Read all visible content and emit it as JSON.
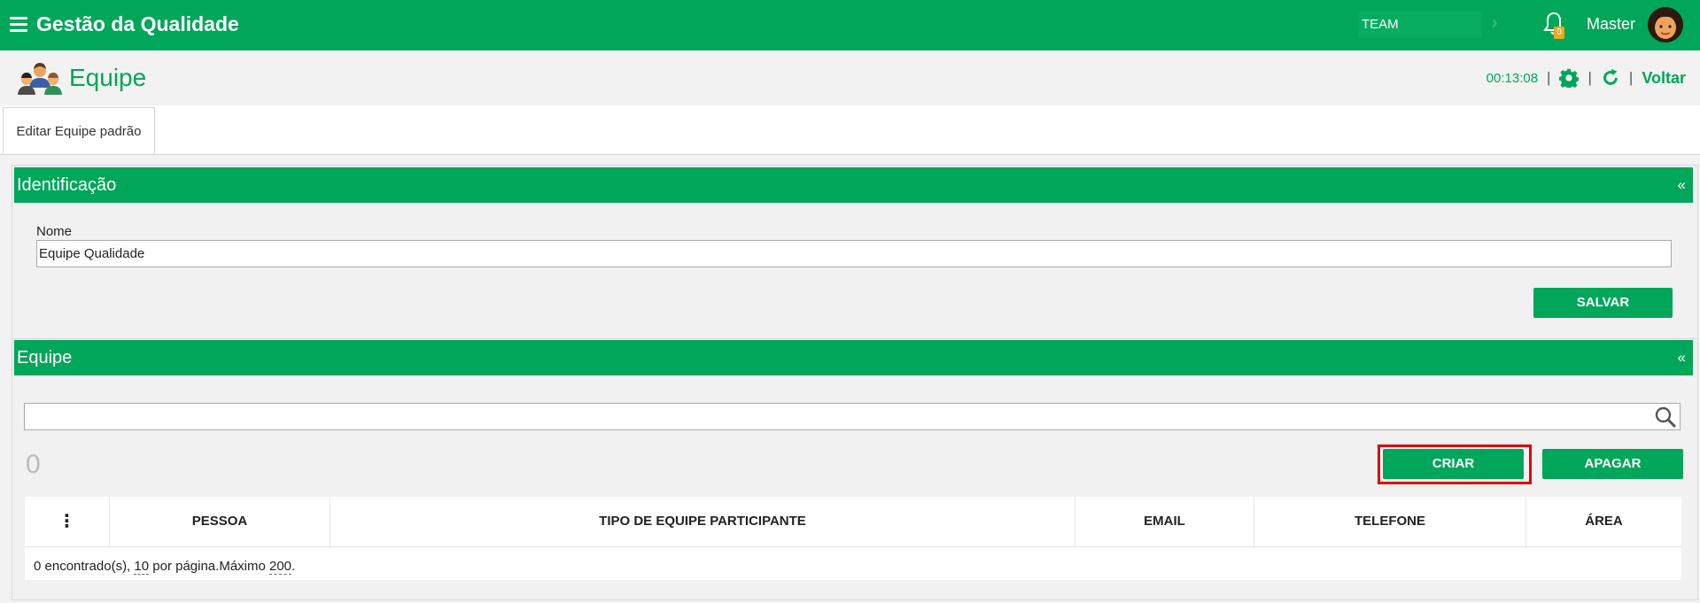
{
  "app": {
    "title": "Gestão da Qualidade",
    "team_selector": "TEAM",
    "notifications_count": "0",
    "user_name": "Master"
  },
  "page": {
    "title": "Equipe",
    "timer": "00:13:08",
    "back_label": "Voltar"
  },
  "tabs": [
    {
      "label": "Editar Equipe padrão"
    }
  ],
  "identification": {
    "section_title": "Identificação",
    "collapse_symbol": "«",
    "name_label": "Nome",
    "name_value": "Equipe Qualidade",
    "save_label": "SALVAR"
  },
  "team": {
    "section_title": "Equipe",
    "collapse_symbol": "«",
    "search_value": "",
    "count": "0",
    "create_label": "CRIAR",
    "delete_label": "APAGAR",
    "columns": [
      "⋮",
      "PESSOA",
      "TIPO DE EQUIPE PARTICIPANTE",
      "EMAIL",
      "TELEFONE",
      "ÁREA"
    ],
    "footer": {
      "found_text": "0 encontrado(s), ",
      "per_page_value": "10",
      "per_page_text": " por página.Máximo ",
      "max_value": "200",
      "end_text": "."
    }
  },
  "colors": {
    "primary": "#00a65a",
    "highlight": "#e00000",
    "badge": "#f5a623"
  },
  "icons": [
    "menu-icon",
    "bell-icon",
    "user-avatar",
    "people-icon",
    "gear-icon",
    "refresh-icon",
    "search-icon",
    "kebab-icon"
  ]
}
